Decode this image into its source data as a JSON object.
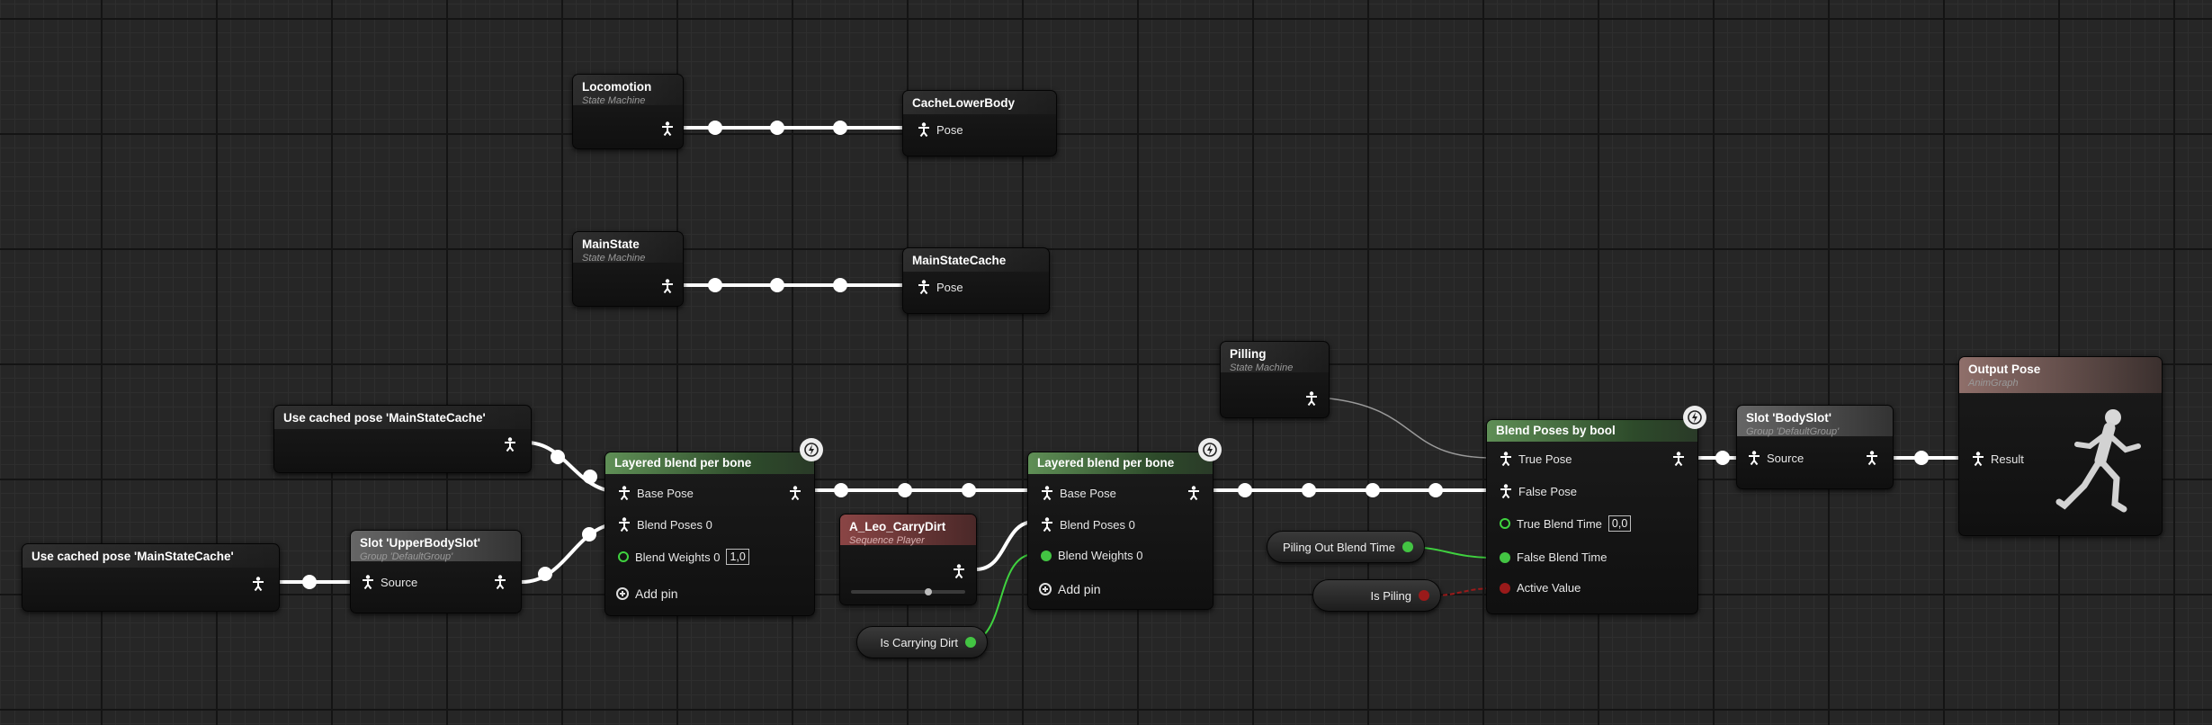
{
  "nodes": {
    "locomotion": {
      "title": "Locomotion",
      "subtitle": "State Machine"
    },
    "cache_lower_body": {
      "title": "CacheLowerBody",
      "pin_pose": "Pose"
    },
    "main_state": {
      "title": "MainState",
      "subtitle": "State Machine"
    },
    "main_state_cache": {
      "title": "MainStateCache",
      "pin_pose": "Pose"
    },
    "pilling": {
      "title": "Pilling",
      "subtitle": "State Machine"
    },
    "use_cached_pose_1": {
      "title": "Use cached pose 'MainStateCache'"
    },
    "use_cached_pose_2": {
      "title": "Use cached pose 'MainStateCache'"
    },
    "slot_upper_body": {
      "title": "Slot 'UpperBodySlot'",
      "subtitle": "Group 'DefaultGroup'",
      "pin_source": "Source"
    },
    "layered_blend_1": {
      "title": "Layered blend per bone",
      "pin_base_pose": "Base Pose",
      "pin_blend_poses": "Blend Poses 0",
      "pin_blend_weights": "Blend Weights 0",
      "blend_weights_value": "1,0",
      "add_pin": "Add pin"
    },
    "sequence_player": {
      "title": "A_Leo_CarryDirt",
      "subtitle": "Sequence Player"
    },
    "layered_blend_2": {
      "title": "Layered blend per bone",
      "pin_base_pose": "Base Pose",
      "pin_blend_poses": "Blend Poses 0",
      "pin_blend_weights": "Blend Weights 0",
      "add_pin": "Add pin"
    },
    "blend_poses_bool": {
      "title": "Blend Poses by bool",
      "pin_true_pose": "True Pose",
      "pin_false_pose": "False Pose",
      "pin_true_blend_time": "True Blend Time",
      "true_blend_time_value": "0,0",
      "pin_false_blend_time": "False Blend Time",
      "pin_active_value": "Active Value"
    },
    "slot_body": {
      "title": "Slot 'BodySlot'",
      "subtitle": "Group 'DefaultGroup'",
      "pin_source": "Source"
    },
    "output_pose": {
      "title": "Output Pose",
      "subtitle": "AnimGraph",
      "pin_result": "Result"
    }
  },
  "variables": {
    "is_carrying_dirt": "Is Carrying Dirt",
    "piling_out_blend_time": "Piling Out Blend Time",
    "is_piling": "Is Piling"
  },
  "colors": {
    "pose_wire": "#ffffff",
    "float_wire": "#3fd23f",
    "bool_wire": "#9a1a1a",
    "blend_header": "#5f8f56",
    "sequence_header": "#8a4545"
  }
}
